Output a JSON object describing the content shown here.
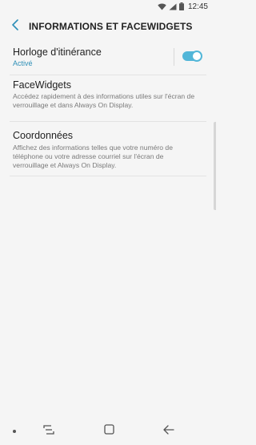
{
  "status_bar": {
    "time": "12:45",
    "icons": [
      "wifi-icon",
      "signal-icon",
      "battery-icon"
    ]
  },
  "header": {
    "back_icon": "back-arrow-icon",
    "title": "INFORMATIONS ET FACEWIDGETS"
  },
  "settings": {
    "roaming_clock": {
      "title": "Horloge d'itinérance",
      "status": "Activé",
      "toggle_on": true
    },
    "facewidgets": {
      "title": "FaceWidgets",
      "description": "Accédez rapidement à des informations utiles sur l'écran de verrouillage et dans Always On Display."
    },
    "contact_info": {
      "title": "Coordonnées",
      "description": "Affichez des informations telles que votre numéro de téléphone ou votre adresse courriel sur l'écran de verrouillage et Always On Display."
    }
  },
  "colors": {
    "accent": "#2e8fb7",
    "toggle": "#52b6d8",
    "background": "#f5f5f5"
  },
  "nav_bar": {
    "icons": [
      "dot-icon",
      "recent-apps-icon",
      "home-icon",
      "back-icon"
    ]
  }
}
